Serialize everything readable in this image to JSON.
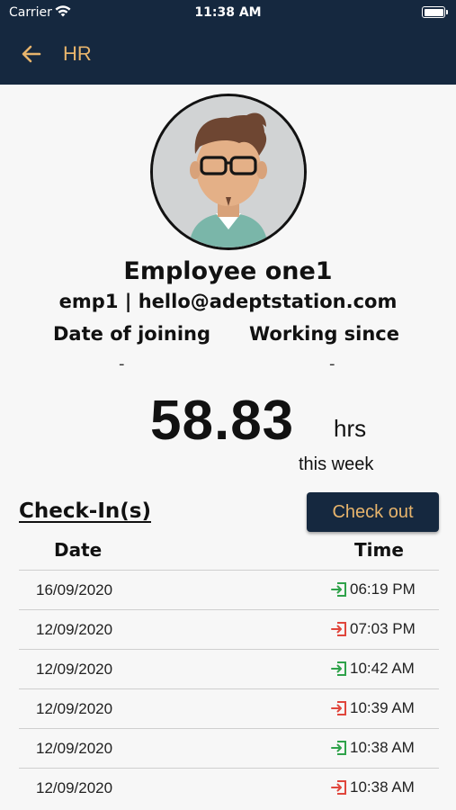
{
  "status_bar": {
    "carrier": "Carrier",
    "time": "11:38 AM"
  },
  "nav": {
    "title": "HR",
    "back_icon": "arrow-left-icon"
  },
  "colors": {
    "header_bg": "#15283f",
    "accent": "#e7b46c",
    "check_in": "#2fa24a",
    "check_out": "#e0463c"
  },
  "profile": {
    "name": "Employee one1",
    "subtitle": "emp1 | hello@adeptstation.com",
    "date_of_joining_label": "Date of joining",
    "date_of_joining_value": "-",
    "working_since_label": "Working since",
    "working_since_value": "-"
  },
  "hours": {
    "value": "58.83",
    "unit": "hrs",
    "caption": "this week"
  },
  "checkins": {
    "title": "Check-In(s)",
    "checkout_label": "Check out",
    "columns": {
      "date": "Date",
      "time": "Time"
    },
    "rows": [
      {
        "date": "16/09/2020",
        "time": "06:19 PM",
        "type": "in"
      },
      {
        "date": "12/09/2020",
        "time": "07:03 PM",
        "type": "out"
      },
      {
        "date": "12/09/2020",
        "time": "10:42 AM",
        "type": "in"
      },
      {
        "date": "12/09/2020",
        "time": "10:39 AM",
        "type": "out"
      },
      {
        "date": "12/09/2020",
        "time": "10:38 AM",
        "type": "in"
      },
      {
        "date": "12/09/2020",
        "time": "10:38 AM",
        "type": "out"
      }
    ]
  }
}
